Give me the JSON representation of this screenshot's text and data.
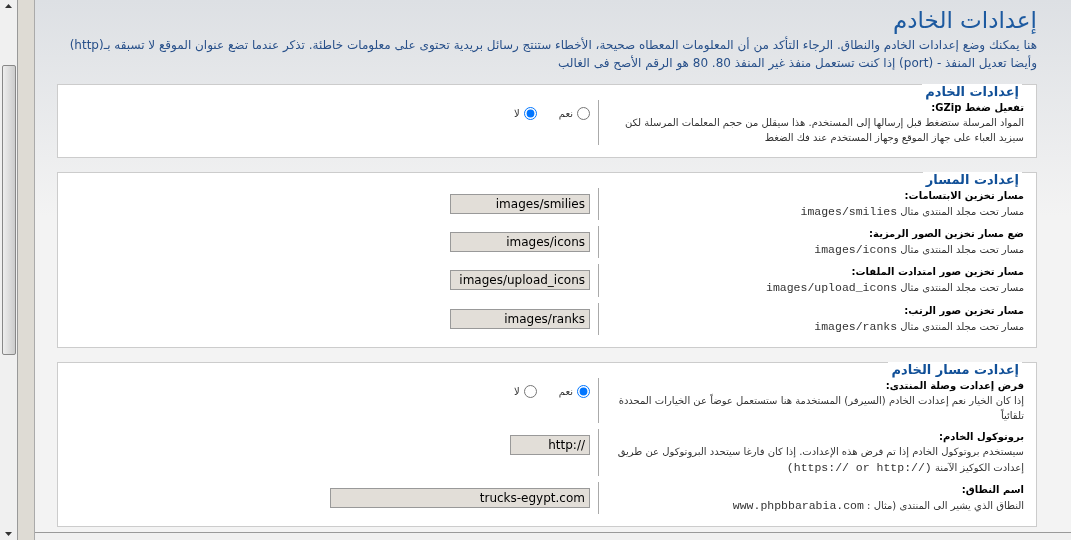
{
  "page": {
    "title": "إعدادات الخادم",
    "intro": "هنا يمكنك وضع إعدادات الخادم والنطاق. الرجاء التأكد من أن المعلومات المعطاه صحيحة، الأخطاء ستنتج رسائل بريدية تحتوى على معلومات خاطئة. تذكر عندما تضع عنوان الموقع لا تسبقه بـ(http) وأيضا تعديل المنفذ - (port) إذا كنت تستعمل منفذ غير المنفذ 80. 80 هو الرقم الأصح فى الغالب"
  },
  "sections": [
    {
      "legend": "إعدادات الخادم",
      "rows": [
        {
          "kind": "radio",
          "label": "تفعيل ضغط GZip:",
          "description": "المواد المرسلة ستضغط قبل إرسالها إلى المستخدم. هذا سيقلل من حجم المعلمات المرسلة لكن سيزيد العباء على جهاز الموقع وجهاز المستخدم عند فك الضغط",
          "options": [
            {
              "label": "نعم",
              "selected": false
            },
            {
              "label": "لا",
              "selected": true
            }
          ]
        }
      ]
    },
    {
      "legend": "إعدادت المسار",
      "rows": [
        {
          "kind": "text",
          "label": "مسار تخزين الابتسامات:",
          "description": "مسار تحت مجلد المنتدى مثال",
          "example": "images/smilies",
          "value": "images/smilies"
        },
        {
          "kind": "text",
          "label": "ضع مسار تخزين الصور الرمزية:",
          "description": "مسار تحت مجلد المنتدى مثال",
          "example": "images/icons",
          "value": "images/icons"
        },
        {
          "kind": "text",
          "label": "مسار تخزين صور امتدادت الملفات:",
          "description": "مسار تحت مجلد المنتدى مثال",
          "example": "images/upload_icons",
          "value": "images/upload_icons"
        },
        {
          "kind": "text",
          "label": "مسار تخزين صور الرتب:",
          "description": "مسار تحت مجلد المنتدى مثال",
          "example": "images/ranks",
          "value": "images/ranks"
        }
      ]
    },
    {
      "legend": "إعدادت مسار الخادم",
      "rows": [
        {
          "kind": "radio",
          "label": "فرض إعدادت وصلة المنتدى:",
          "description": "إذا كان الخيار نعم إعدادت الخادم (السيرفر) المستخدمة هنا ستستعمل عوضاً عن الخيارات المحددة تلقائياً",
          "options": [
            {
              "label": "نعم",
              "selected": true
            },
            {
              "label": "لا",
              "selected": false
            }
          ]
        },
        {
          "kind": "short",
          "label": "بروتوكول الخادم:",
          "description": "سيستخدم بروتوكول الخادم إذا تم فرض هذه الإعدادت. إذا كان فارغا سيتحدد البروتوكول عن طريق إعدادت الكوكيز الآمنة",
          "example": "(https:// or http://)",
          "value": "http://"
        },
        {
          "kind": "wide",
          "label": "اسم النطاق:",
          "description": "النطاق الذي يشير الى المنتدى (مثال :",
          "example": "www.phpbbarabia.com",
          "value": "trucks-egypt.com"
        }
      ]
    }
  ]
}
